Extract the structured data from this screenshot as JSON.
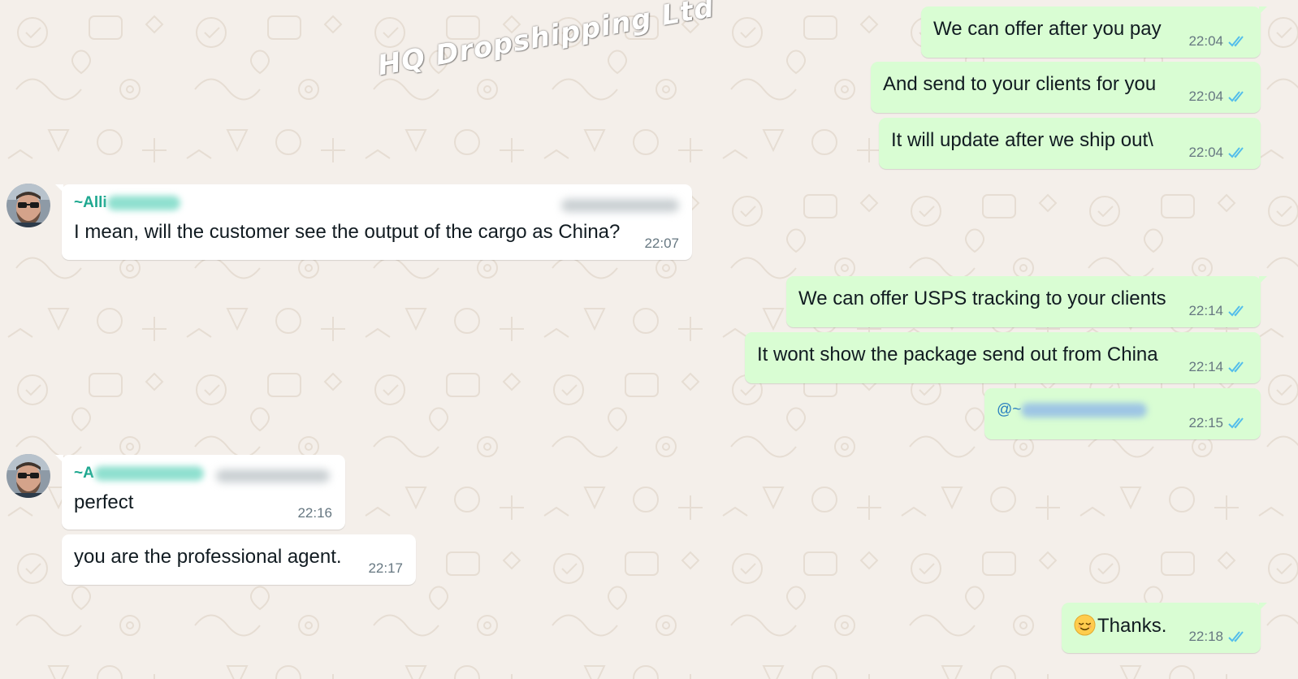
{
  "watermark": "HQ Dropshipping Ltd",
  "colors": {
    "outgoing_bubble": "#d9fdd3",
    "incoming_bubble": "#ffffff",
    "read_ticks": "#53bdeb",
    "sender_name": "#1fa890",
    "wallpaper": "#f4efea"
  },
  "messages": [
    {
      "direction": "outgoing",
      "text": "We can offer after you pay",
      "time": "22:04",
      "status_icon": "double-check-read-icon"
    },
    {
      "direction": "outgoing",
      "text": "And send to your clients for you",
      "time": "22:04",
      "status_icon": "double-check-read-icon"
    },
    {
      "direction": "outgoing",
      "text": "It will update after we ship out\\",
      "time": "22:04",
      "status_icon": "double-check-read-icon"
    },
    {
      "direction": "incoming",
      "sender": "~Alli",
      "text": "I mean, will the customer see the output of the cargo as China?",
      "time": "22:07",
      "avatar_icon": "bearded-man-sunglasses-avatar"
    },
    {
      "direction": "outgoing",
      "text": "We can offer USPS tracking to your clients",
      "time": "22:14",
      "status_icon": "double-check-read-icon"
    },
    {
      "direction": "outgoing",
      "text": "It wont show the package send out from China",
      "time": "22:14",
      "status_icon": "double-check-read-icon"
    },
    {
      "direction": "outgoing",
      "mention": "@~",
      "time": "22:15",
      "status_icon": "double-check-read-icon"
    },
    {
      "direction": "incoming",
      "sender": "~A",
      "text": "perfect",
      "time": "22:16",
      "avatar_icon": "bearded-man-sunglasses-avatar"
    },
    {
      "direction": "incoming",
      "text": "you are the professional agent.",
      "time": "22:17"
    },
    {
      "direction": "outgoing",
      "emoji": "relieved-face-emoji",
      "text": "Thanks.",
      "time": "22:18",
      "status_icon": "double-check-read-icon"
    }
  ]
}
